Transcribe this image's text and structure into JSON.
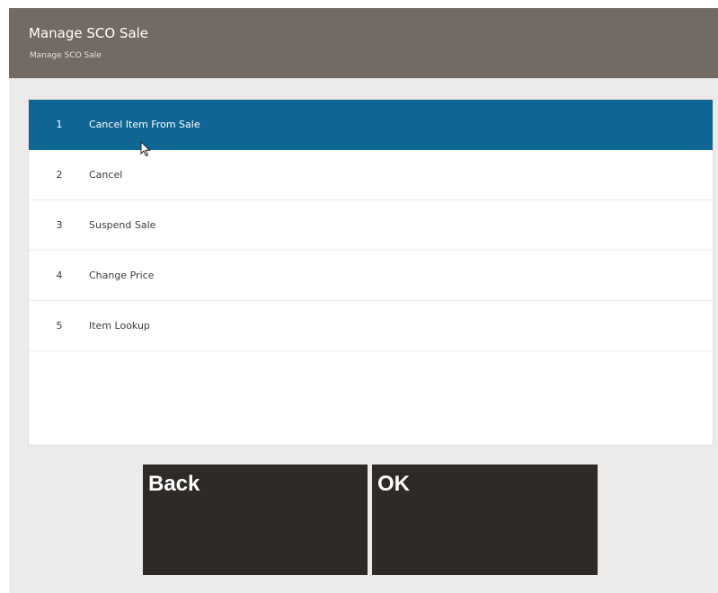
{
  "header": {
    "title": "Manage SCO Sale",
    "subtitle": "Manage SCO Sale"
  },
  "menu": {
    "items": [
      {
        "number": "1",
        "label": "Cancel Item From Sale",
        "selected": true
      },
      {
        "number": "2",
        "label": "Cancel",
        "selected": false
      },
      {
        "number": "3",
        "label": "Suspend Sale",
        "selected": false
      },
      {
        "number": "4",
        "label": "Change Price",
        "selected": false
      },
      {
        "number": "5",
        "label": "Item Lookup",
        "selected": false
      }
    ]
  },
  "buttons": {
    "back_label": "Back",
    "ok_label": "OK"
  },
  "colors": {
    "header_bg": "#746a64",
    "selected_row_bg": "#0f6594",
    "button_bg": "#2d2a27",
    "page_bg": "#ecebea"
  },
  "icons": {
    "cursor": "mouse-pointer-icon"
  }
}
